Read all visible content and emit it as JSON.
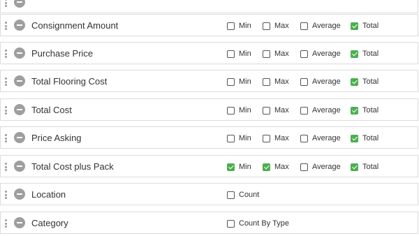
{
  "fields": [
    {
      "label": "",
      "options": []
    },
    {
      "label": "Consignment Amount",
      "options": [
        {
          "label": "Min",
          "checked": false
        },
        {
          "label": "Max",
          "checked": false
        },
        {
          "label": "Average",
          "checked": false
        },
        {
          "label": "Total",
          "checked": true
        }
      ]
    },
    {
      "label": "Purchase Price",
      "options": [
        {
          "label": "Min",
          "checked": false
        },
        {
          "label": "Max",
          "checked": false
        },
        {
          "label": "Average",
          "checked": false
        },
        {
          "label": "Total",
          "checked": true
        }
      ]
    },
    {
      "label": "Total Flooring Cost",
      "options": [
        {
          "label": "Min",
          "checked": false
        },
        {
          "label": "Max",
          "checked": false
        },
        {
          "label": "Average",
          "checked": false
        },
        {
          "label": "Total",
          "checked": true
        }
      ]
    },
    {
      "label": "Total Cost",
      "options": [
        {
          "label": "Min",
          "checked": false
        },
        {
          "label": "Max",
          "checked": false
        },
        {
          "label": "Average",
          "checked": false
        },
        {
          "label": "Total",
          "checked": true
        }
      ]
    },
    {
      "label": "Price Asking",
      "options": [
        {
          "label": "Min",
          "checked": false
        },
        {
          "label": "Max",
          "checked": false
        },
        {
          "label": "Average",
          "checked": false
        },
        {
          "label": "Total",
          "checked": true
        }
      ]
    },
    {
      "label": "Total Cost plus Pack",
      "options": [
        {
          "label": "Min",
          "checked": true
        },
        {
          "label": "Max",
          "checked": true
        },
        {
          "label": "Average",
          "checked": false
        },
        {
          "label": "Total",
          "checked": true
        }
      ]
    },
    {
      "label": "Location",
      "options": [
        {
          "label": "Count",
          "checked": false
        }
      ]
    },
    {
      "label": "Category",
      "options": [
        {
          "label": "Count By Type",
          "checked": false
        }
      ]
    }
  ],
  "colors": {
    "checked": "#4caf50",
    "remove_icon": "#9e9e9e",
    "row_border": "#dcdcdc"
  },
  "icons": {
    "drag": "drag-handle-icon",
    "remove": "remove-circle-icon"
  }
}
